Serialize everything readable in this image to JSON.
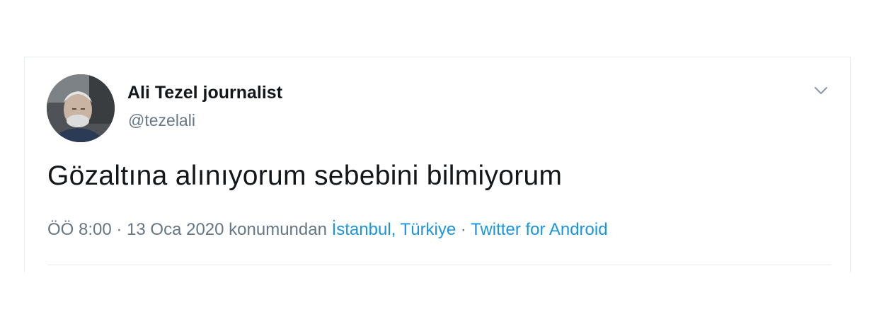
{
  "tweet": {
    "display_name": "Ali Tezel journalist",
    "handle": "@tezelali",
    "text": "Gözaltına alınıyorum sebebini bilmiyorum",
    "time": "ÖÖ 8:00",
    "separator": " · ",
    "date": "13 Oca 2020",
    "location_prefix": " konumundan ",
    "location": "İstanbul, Türkiye",
    "source": "Twitter for Android"
  },
  "icons": {
    "menu": "chevron-down-icon",
    "avatar": "user-photo"
  },
  "colors": {
    "link": "#1b95e0",
    "secondary_text": "#657786",
    "primary_text": "#14171a",
    "border": "#e6ecf0"
  }
}
